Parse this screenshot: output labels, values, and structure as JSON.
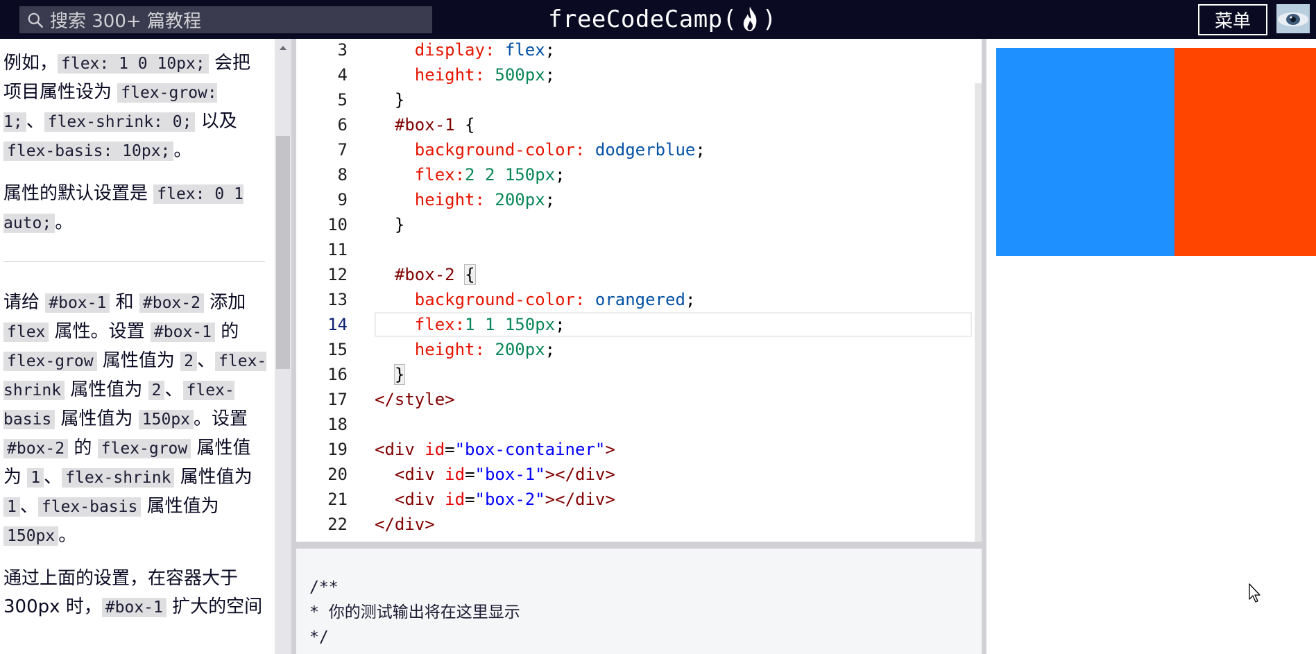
{
  "navbar": {
    "search_placeholder": "搜索 300+ 篇教程",
    "brand_text": "freeCodeCamp(",
    "brand_close": ")",
    "menu_label": "菜单",
    "icons": [
      "search-icon",
      "flame-icon",
      "avatar"
    ],
    "colors": {
      "background": "#0a0a23",
      "search_bg": "#3b3b4f"
    }
  },
  "instructions": {
    "p1": {
      "t1": "例如，",
      "c1": "flex: 1 0 10px;",
      "t2": " 会把项目属性设为 ",
      "c2": "flex-grow: 1;",
      "t3": "、",
      "c3": "flex-shrink: 0;",
      "t4": " 以及 ",
      "c4": "flex-basis: 10px;",
      "t5": "。"
    },
    "p2": {
      "t1": "属性的默认设置是 ",
      "c1": "flex: 0 1 auto;",
      "t2": "。"
    },
    "p3": {
      "t1": "请给 ",
      "c1": "#box-1",
      "t2": " 和 ",
      "c2": "#box-2",
      "t3": " 添加 ",
      "c3": "flex",
      "t4": " 属性。设置 ",
      "c4": "#box-1",
      "t5": " 的 ",
      "c5": "flex-grow",
      "t6": " 属性值为 ",
      "c6": "2",
      "t7": "、",
      "c7": "flex-shrink",
      "t8": " 属性值为 ",
      "c8": "2",
      "t9": "、",
      "c9": "flex-basis",
      "t10": " 属性值为 ",
      "c10": "150px",
      "t11": "。设置 ",
      "c11": "#box-2",
      "t12": " 的 ",
      "c12": "flex-grow",
      "t13": " 属性值为 ",
      "c13": "1",
      "t14": "、",
      "c14": "flex-shrink",
      "t15": " 属性值为 ",
      "c15": "1",
      "t16": "、",
      "c16": "flex-basis",
      "t17": " 属性值为 ",
      "c17": "150px",
      "t18": "。"
    },
    "p4": {
      "t1": "通过上面的设置，在容器大于 300px 时，",
      "c1": "#box-1",
      "t2": " 扩大的空间"
    }
  },
  "editor": {
    "active_line": "14",
    "lines": [
      {
        "num": "3",
        "indent": "    ",
        "prop": "display:",
        "val": " flex",
        "end": ";"
      },
      {
        "num": "4",
        "indent": "    ",
        "prop": "height:",
        "num_val": " 500px",
        "end": ";"
      },
      {
        "num": "5",
        "indent": "  ",
        "plain": "}"
      },
      {
        "num": "6",
        "indent": "  ",
        "tag_sel": "#box-1",
        "plain": " {"
      },
      {
        "num": "7",
        "indent": "    ",
        "prop": "background-color:",
        "val": " dodgerblue",
        "end": ";"
      },
      {
        "num": "8",
        "indent": "    ",
        "prop": "flex:",
        "num_val": "2 2 150px",
        "end": ";"
      },
      {
        "num": "9",
        "indent": "    ",
        "prop": "height:",
        "num_val": " 200px",
        "end": ";"
      },
      {
        "num": "10",
        "indent": "  ",
        "plain": "}"
      },
      {
        "num": "11",
        "indent": "",
        "plain": ""
      },
      {
        "num": "12",
        "indent": "  ",
        "tag_sel": "#box-2",
        "plain": " {"
      },
      {
        "num": "13",
        "indent": "    ",
        "prop": "background-color:",
        "val": " orangered",
        "end": ";"
      },
      {
        "num": "14",
        "indent": "    ",
        "prop": "flex:",
        "num_val": "1 1 150px",
        "end": ";"
      },
      {
        "num": "15",
        "indent": "    ",
        "prop": "height:",
        "num_val": " 200px",
        "end": ";"
      },
      {
        "num": "16",
        "indent": "  ",
        "plain": "}"
      },
      {
        "num": "17",
        "indent": "",
        "tag": "</style>"
      },
      {
        "num": "18",
        "indent": "",
        "plain": ""
      },
      {
        "num": "19",
        "indent": "",
        "tag_open": "<div",
        "attr": " id",
        "eq": "=",
        "str": "\"box-container\"",
        "tag_close": ">"
      },
      {
        "num": "20",
        "indent": "  ",
        "tag_open": "<div",
        "attr": " id",
        "eq": "=",
        "str": "\"box-1\"",
        "tag_close": "></div>"
      },
      {
        "num": "21",
        "indent": "  ",
        "tag_open": "<div",
        "attr": " id",
        "eq": "=",
        "str": "\"box-2\"",
        "tag_close": "></div>"
      },
      {
        "num": "22",
        "indent": "",
        "tag": "</div>"
      }
    ]
  },
  "console": {
    "line1": "/**",
    "line2": "* 你的测试输出将在这里显示",
    "line3": "*/"
  },
  "preview": {
    "box_1_color": "#1e90ff",
    "box_2_color": "#ff4500"
  }
}
